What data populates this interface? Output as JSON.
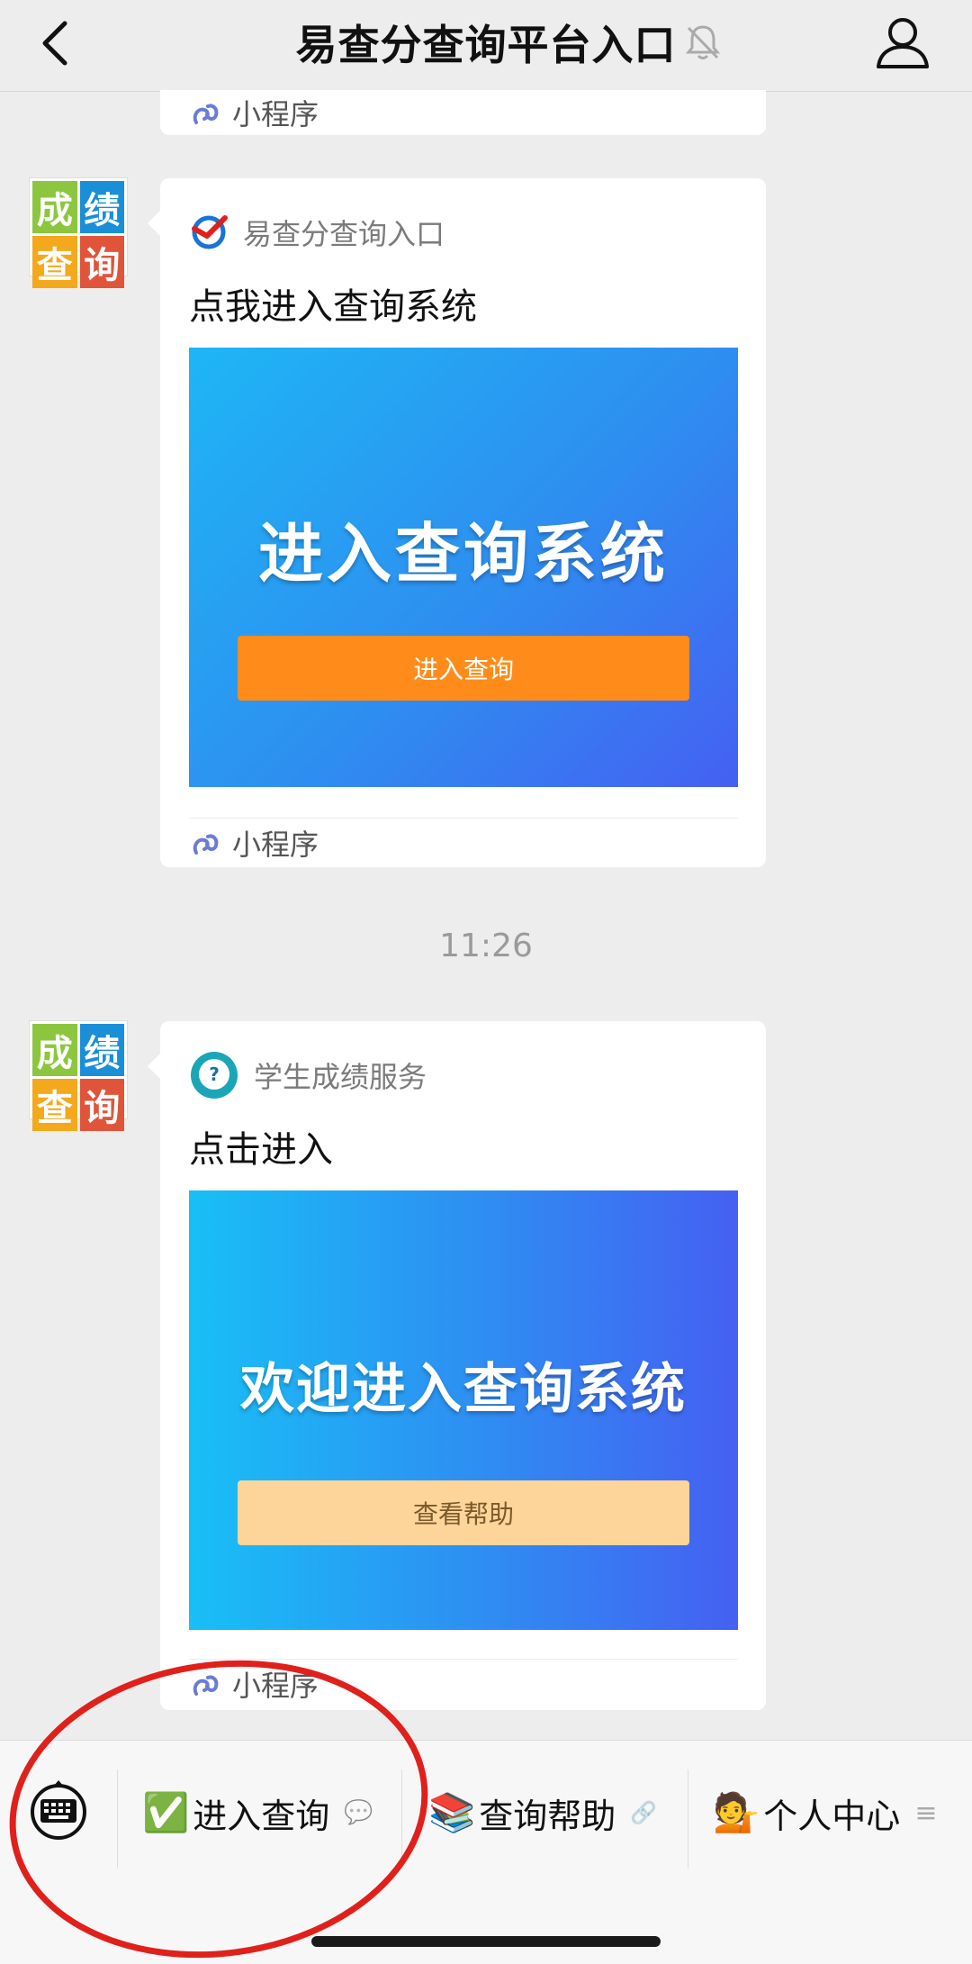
{
  "header": {
    "title": "易查分查询平台入口",
    "back_icon": "chevron-left-icon",
    "mute_icon": "bell-slash-icon",
    "profile_icon": "person-icon"
  },
  "avatar": {
    "cells": [
      "成",
      "绩",
      "查",
      "询"
    ],
    "colors": [
      "#8cc63f",
      "#1a8fd8",
      "#f4a81c",
      "#e0553a"
    ]
  },
  "messages": [
    {
      "mini_program_label": "小程序"
    },
    {
      "source": "易查分查询入口",
      "title": "点我进入查询系统",
      "banner_heading": "进入查询系统",
      "banner_button": "进入查询",
      "mini_program_label": "小程序"
    },
    {
      "source": "学生成绩服务",
      "title": "点击进入",
      "banner_heading": "欢迎进入查询系统",
      "banner_button": "查看帮助",
      "mini_program_label": "小程序"
    }
  ],
  "timestamp": "11:26",
  "menu": {
    "keyboard_icon": "keyboard-icon",
    "items": [
      {
        "emoji": "✅",
        "label": "进入查询",
        "suffix": "💬"
      },
      {
        "emoji": "📚",
        "label": "查询帮助",
        "suffix": "🔗"
      },
      {
        "emoji": "💁",
        "label": "个人中心",
        "suffix": "≡"
      }
    ]
  },
  "colors": {
    "accent_orange": "#ff8c1a",
    "help_button": "#fdd59a",
    "annotation_red": "#e0201b",
    "banner_blue_start": "#1eb6f5",
    "banner_blue_end": "#4560f2"
  }
}
